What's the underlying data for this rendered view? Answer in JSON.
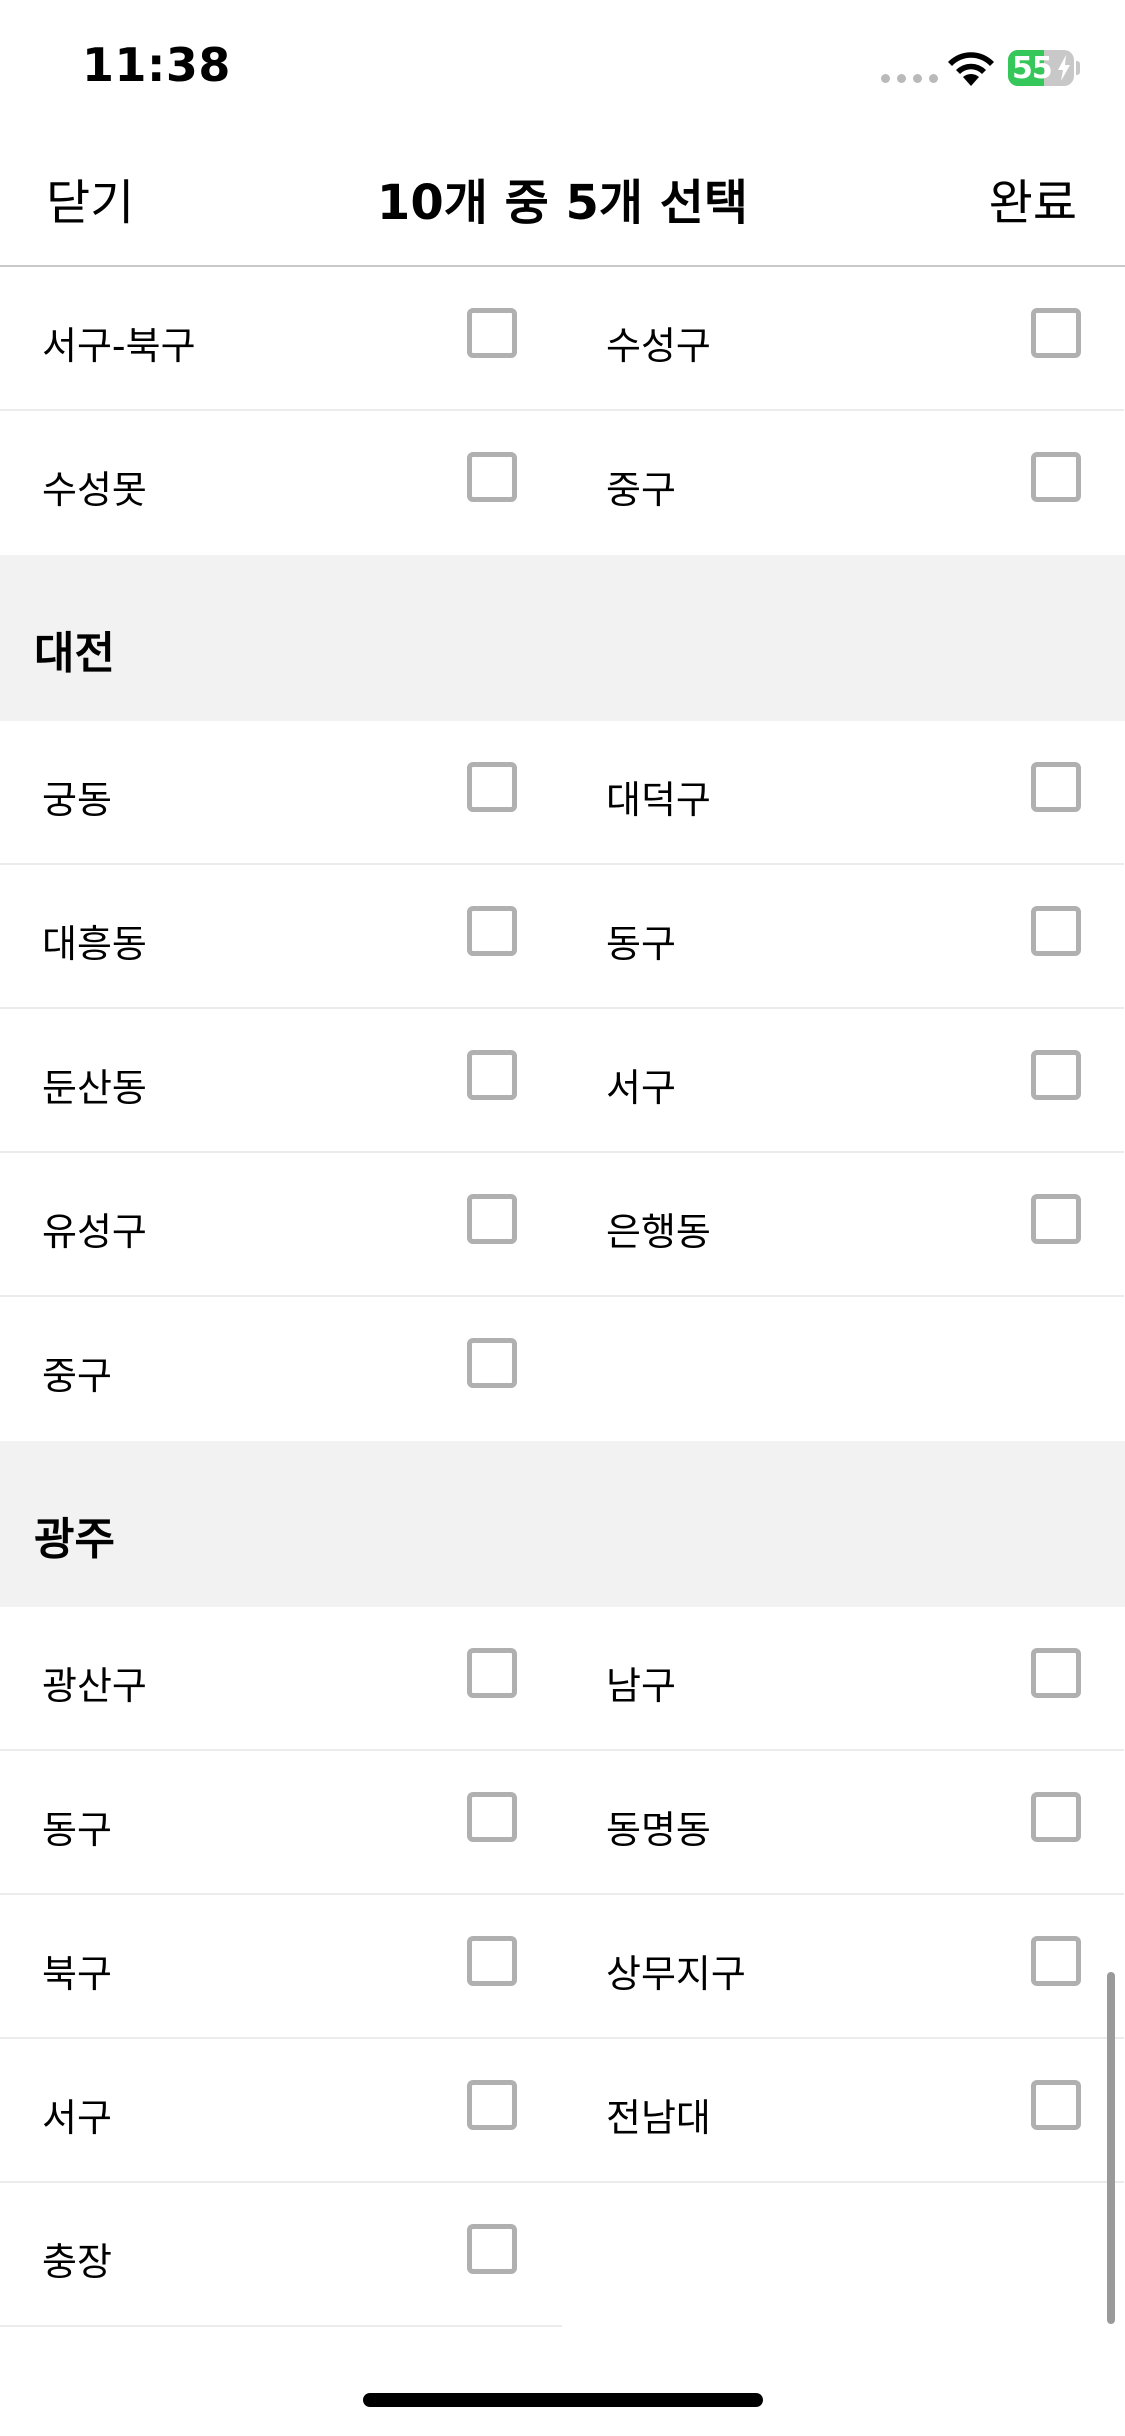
{
  "status_bar": {
    "time": "11:38",
    "battery_level": "55",
    "battery_fraction": 0.55,
    "battery_color": "#35c759",
    "icons": [
      "signal-dots-icon",
      "wifi-icon",
      "battery-charging-icon"
    ]
  },
  "nav": {
    "close_label": "닫기",
    "title": "10개 중 5개 선택",
    "done_label": "완료"
  },
  "top_rows": [
    [
      "서구-북구",
      "수성구"
    ],
    [
      "수성못",
      "중구"
    ]
  ],
  "sections": [
    {
      "title": "대전",
      "rows": [
        [
          "궁동",
          "대덕구"
        ],
        [
          "대흥동",
          "동구"
        ],
        [
          "둔산동",
          "서구"
        ],
        [
          "유성구",
          "은행동"
        ],
        [
          "중구"
        ]
      ]
    },
    {
      "title": "광주",
      "rows": [
        [
          "광산구",
          "남구"
        ],
        [
          "동구",
          "동명동"
        ],
        [
          "북구",
          "상무지구"
        ],
        [
          "서구",
          "전남대"
        ],
        [
          "충장"
        ]
      ]
    }
  ]
}
